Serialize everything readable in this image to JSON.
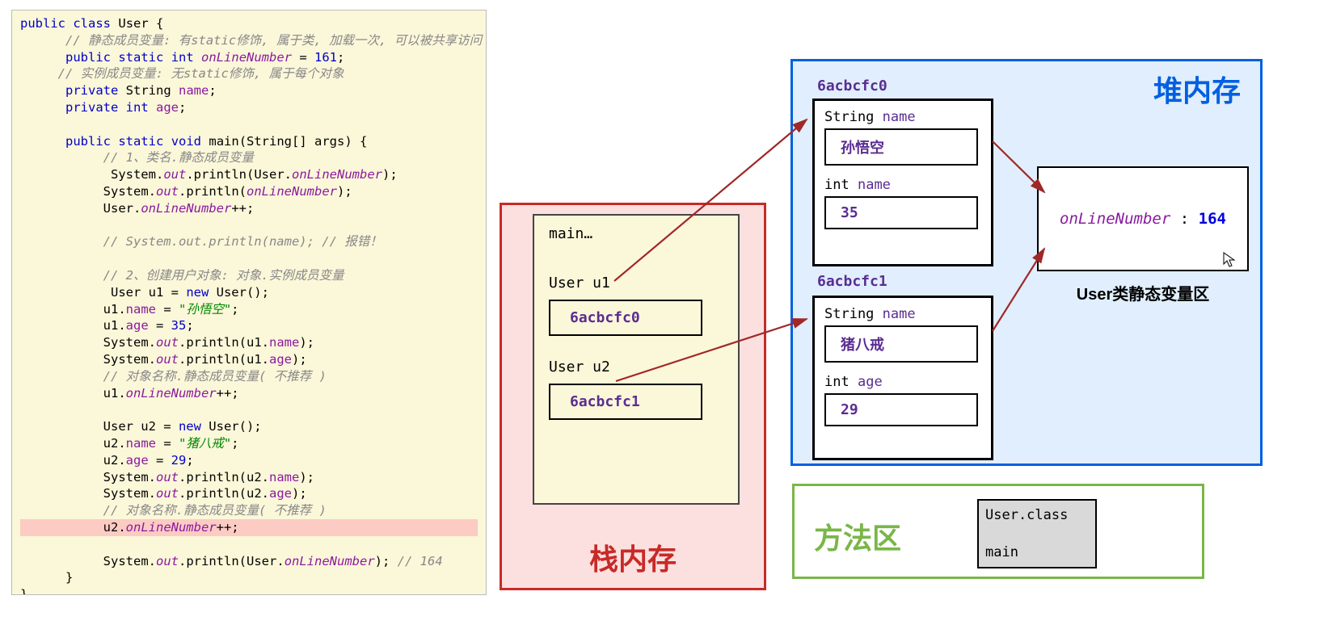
{
  "code": {
    "class_name": "User",
    "static_var_comment": "// 静态成员变量: 有static修饰, 属于类, 加载一次, 可以被共享访问",
    "onLineNumber_decl": "onLineNumber",
    "onLineNumber_init": "161",
    "instance_var_comment": "// 实例成员变量: 无static修饰, 属于每个对象",
    "name_field": "name",
    "age_field": "age",
    "main_sig": "main",
    "comment1": "// 1、类名.静态成员变量",
    "comment_err": "// System.out.println(name); // 报错！",
    "comment2": "// 2、创建用户对象: 对象.实例成员变量",
    "u1_name_val": "\"孙悟空\"",
    "u1_age_val": "35",
    "comment_nr": "// 对象名称.静态成员变量( 不推荐 )",
    "u2_name_val": "\"猪八戒\"",
    "u2_age_val": "29",
    "last_comment": "// 164"
  },
  "stack": {
    "title": "栈内存",
    "main": "main…",
    "u1": "User u1",
    "u1_addr": "6acbcfc0",
    "u2": "User u2",
    "u2_addr": "6acbcfc1"
  },
  "heap": {
    "title": "堆内存",
    "obj0_addr": "6acbcfc0",
    "obj0_name_type": "String",
    "obj0_name_field": "name",
    "obj0_name_val": "孙悟空",
    "obj0_age_type": "int",
    "obj0_age_field": "name",
    "obj0_age_val": "35",
    "obj1_addr": "6acbcfc1",
    "obj1_name_type": "String",
    "obj1_name_field": "name",
    "obj1_name_val": "猪八戒",
    "obj1_age_type": "int",
    "obj1_age_field": "age",
    "obj1_age_val": "29",
    "static_name": "onLineNumber",
    "static_sep": " : ",
    "static_val": "164",
    "static_label": "User类静态变量区"
  },
  "method": {
    "title": "方法区",
    "class": "User.class",
    "main": "main"
  },
  "kw": {
    "public": "public",
    "class": "class",
    "static": "static",
    "int": "int",
    "private": "private",
    "String": "String",
    "void": "void",
    "new": "new",
    "System": "System",
    "out": "out",
    "println": "println",
    "User": "User"
  }
}
